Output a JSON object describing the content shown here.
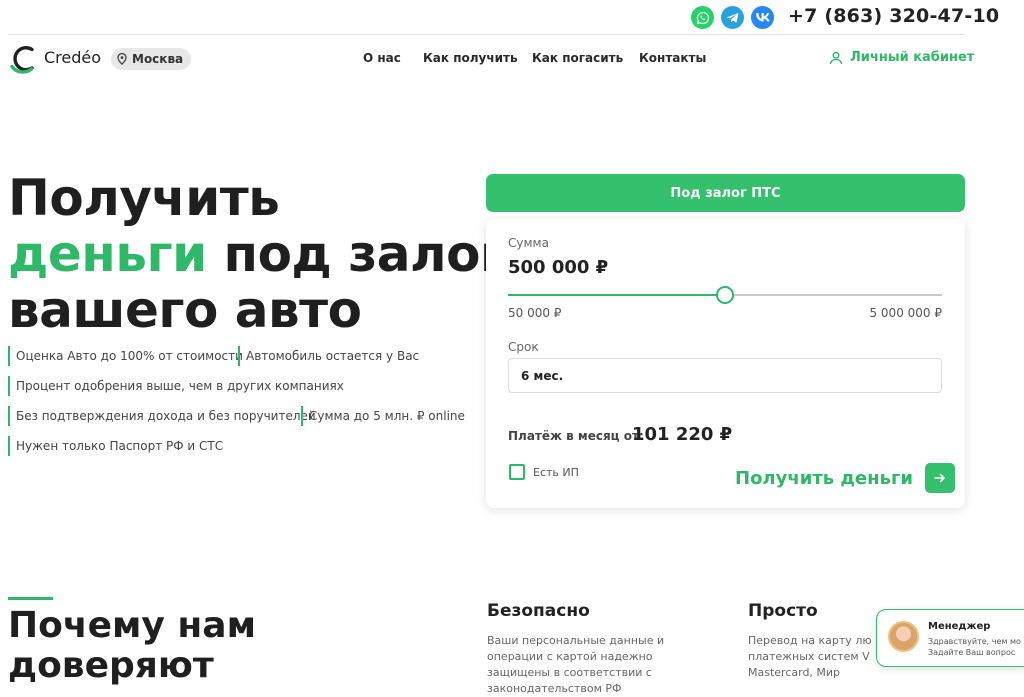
{
  "topbar": {
    "messengers": [
      "whatsapp-icon",
      "telegram-icon",
      "vk-icon"
    ],
    "phone": "+7 (863) 320-47-10"
  },
  "header": {
    "logo_text": "Credéo",
    "city": "Москва",
    "nav": [
      "О нас",
      "Как получить",
      "Как погасить",
      "Контакты"
    ],
    "cabinet": "Личный кабинет"
  },
  "hero": {
    "title_line1": "Получить",
    "title_accent": "деньги",
    "title_line2_rest": " под залог",
    "title_line3": "вашего авто",
    "features": [
      "Оценка Авто до 100% от стоимости",
      "Автомобиль остается у Вас",
      "Процент одобрения выше, чем в других компаниях",
      "Без подтверждения дохода и без поручителей",
      "Сумма до 5 млн. ₽ online",
      "Нужен только Паспорт РФ и СТС"
    ]
  },
  "calculator": {
    "tab": "Под залог ПТС",
    "amount_label": "Сумма",
    "amount": "500 000 ₽",
    "slider_min": "50 000 ₽",
    "slider_max": "5 000 000 ₽",
    "slider_value": 500000,
    "slider_min_value": 50000,
    "slider_max_value": 5000000,
    "term_label": "Срок",
    "term": "6 мес.",
    "payment_label": "Платёж в месяц от:",
    "payment": "101 220 ₽",
    "ip_label": "Есть ИП",
    "ip_checked": false,
    "submit": "Получить деньги"
  },
  "why": {
    "title_line1": "Почему нам",
    "title_line2": "доверяют",
    "columns": [
      {
        "title": "Безопасно",
        "lines": [
          "Ваши персональные данные и",
          "операции с картой надежно",
          "защищены в соответствии с",
          "законодательством РФ"
        ]
      },
      {
        "title": "Просто",
        "lines": [
          "Перевод на карту лю",
          "платежных систем V",
          "Mastercard, Мир"
        ]
      }
    ]
  },
  "chat": {
    "name": "Менеджер",
    "line1": "Здравствуйте, чем мо",
    "line2": "Задайте Ваш вопрос"
  },
  "colors": {
    "accent": "#2eb867",
    "button": "#34c06d",
    "whatsapp": "#25d366",
    "telegram": "#2aa1da",
    "vk": "#2787f5"
  }
}
